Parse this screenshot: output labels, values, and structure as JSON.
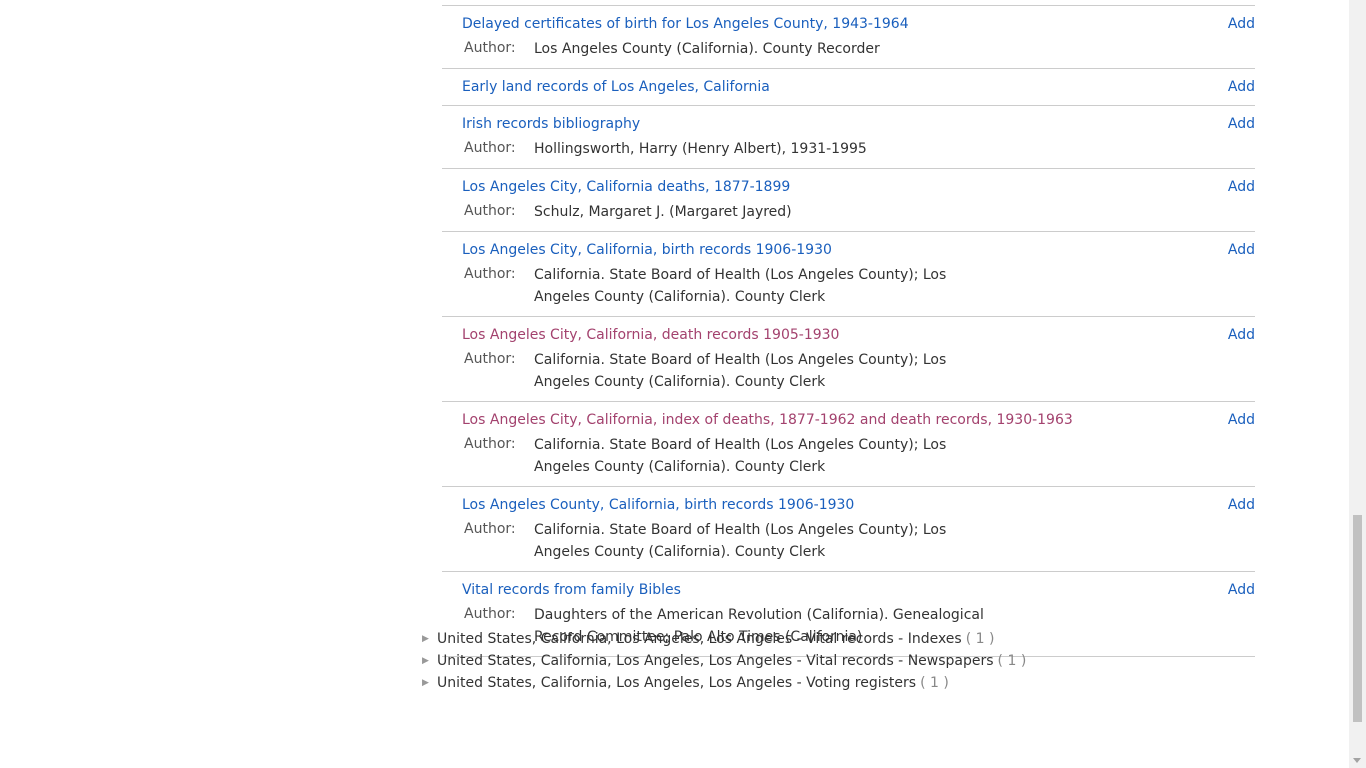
{
  "results": [
    {
      "title": "Delayed certificates of birth for Los Angeles County, 1943-1964",
      "visited": false,
      "author": "Los Angeles County (California). County Recorder"
    },
    {
      "title": "Early land records of Los Angeles, California",
      "visited": false,
      "author": null
    },
    {
      "title": "Irish records bibliography",
      "visited": false,
      "author": "Hollingsworth, Harry (Henry Albert), 1931-1995"
    },
    {
      "title": "Los Angeles City, California deaths, 1877-1899",
      "visited": false,
      "author": "Schulz, Margaret J. (Margaret Jayred)"
    },
    {
      "title": "Los Angeles City, California, birth records 1906-1930",
      "visited": false,
      "author": "California. State Board of Health (Los Angeles County); Los Angeles County (California). County Clerk"
    },
    {
      "title": "Los Angeles City, California, death records 1905-1930",
      "visited": true,
      "author": "California. State Board of Health (Los Angeles County); Los Angeles County (California). County Clerk"
    },
    {
      "title": "Los Angeles City, California, index of deaths, 1877-1962 and death records, 1930-1963",
      "visited": true,
      "author": "California. State Board of Health (Los Angeles County); Los Angeles County (California). County Clerk"
    },
    {
      "title": "Los Angeles County, California, birth records 1906-1930",
      "visited": false,
      "author": "California. State Board of Health (Los Angeles County); Los Angeles County (California). County Clerk"
    },
    {
      "title": "Vital records from family Bibles",
      "visited": false,
      "author": "Daughters of the American Revolution (California). Genealogical Record Committee; Palo Alto Times (California)"
    }
  ],
  "labels": {
    "add": "Add",
    "author": "Author:"
  },
  "subjects": [
    {
      "label": "United States, California, Los Angeles, Los Angeles - Vital records - Indexes",
      "count": "( 1 )"
    },
    {
      "label": "United States, California, Los Angeles, Los Angeles - Vital records - Newspapers",
      "count": "( 1 )"
    },
    {
      "label": "United States, California, Los Angeles, Los Angeles - Voting registers",
      "count": "( 1 )"
    }
  ],
  "colors": {
    "link": "#1a5fbd",
    "visited": "#a3426e",
    "border": "#cccccc"
  }
}
